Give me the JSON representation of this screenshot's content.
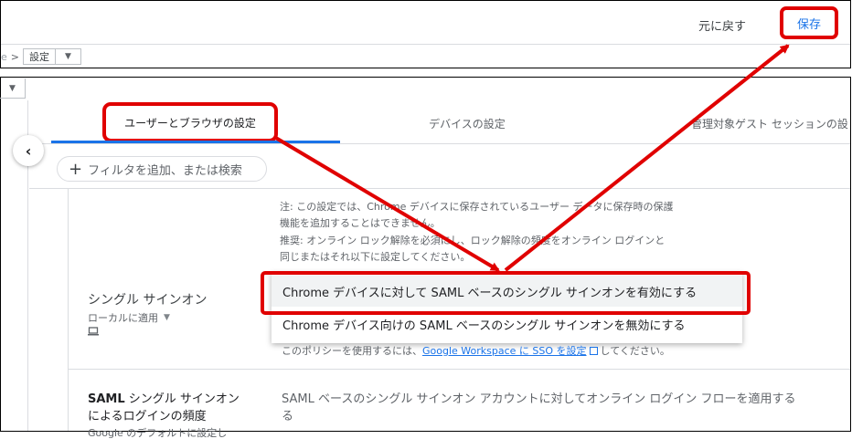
{
  "header": {
    "undo_label": "元に戻す",
    "save_label": "保存",
    "breadcrumb_prefix": "e",
    "breadcrumb_sep": ">",
    "breadcrumb_current": "設定"
  },
  "tabs": [
    {
      "label": "ユーザーとブラウザの設定"
    },
    {
      "label": "デバイスの設定"
    },
    {
      "label": "管理対象ゲスト セッションの設"
    }
  ],
  "filter": {
    "placeholder": "フィルタを追加、または検索"
  },
  "note_lines": [
    "注: この設定では、Chrome デバイスに保存されているユーザー データに保存時の保護",
    "機能を追加することはできません。",
    "推奨: オンライン ロック解除を必須にし、ロック解除の頻度をオンライン ログインと",
    "同じまたはそれ以下に設定してください。"
  ],
  "sso_setting": {
    "title": "シングル サインオン",
    "scope": "ローカルに適用",
    "options": [
      "Chrome デバイスに対して SAML ベースのシングル サインオンを有効にする",
      "Chrome デバイス向けの SAML ベースのシングル サインオンを無効にする"
    ],
    "note_prefix": "このポリシーを使用するには、",
    "note_link": "Google Workspace に SSO を設定",
    "note_suffix": "してください。"
  },
  "freq_setting": {
    "title_bold": "SAML",
    "title_rest": " シングル サインオン",
    "title_line2": "によるログインの頻度",
    "subtitle": "Google のデフォルトに設定し",
    "description": "SAML ベースのシングル サインオン アカウントに対してオンライン ログイン フローを適用する",
    "description_line2": "る"
  },
  "colors": {
    "accent": "#1a73e8",
    "annotation_red": "#e00000"
  }
}
